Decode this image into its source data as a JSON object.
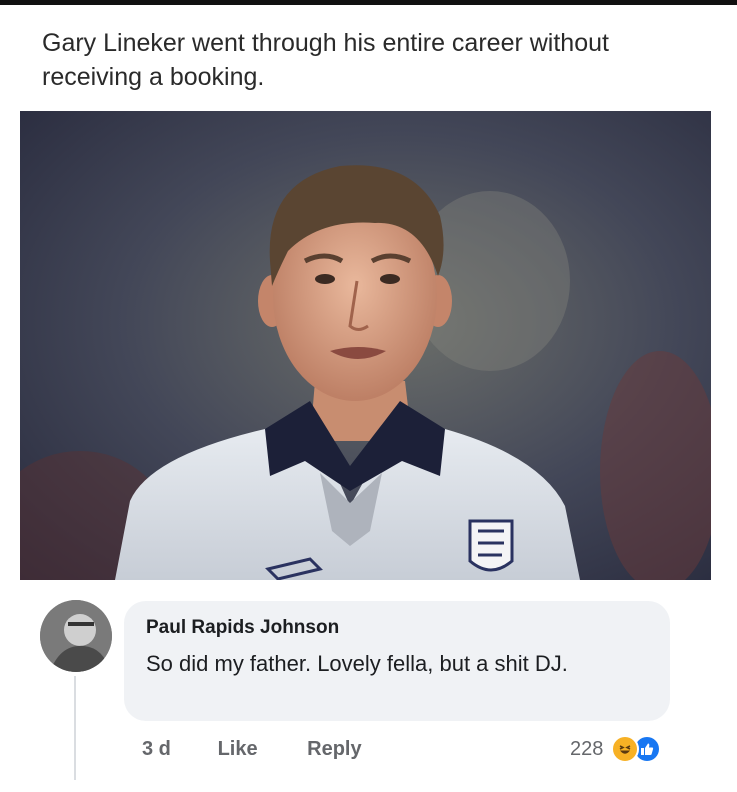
{
  "post": {
    "text": "Gary Lineker went through his entire career without receiving a booking."
  },
  "comment": {
    "author": "Paul Rapids Johnson",
    "text": "So did my father. Lovely fella,  but a shit DJ.",
    "time": "3 d",
    "like_label": "Like",
    "reply_label": "Reply",
    "reaction_count": "228",
    "reaction_icons": [
      "haha-icon",
      "like-icon"
    ]
  },
  "colors": {
    "bubble": "#f0f2f5",
    "secondary_text": "#65676b",
    "like_blue": "#1877f2",
    "haha_yellow": "#f7b125"
  }
}
